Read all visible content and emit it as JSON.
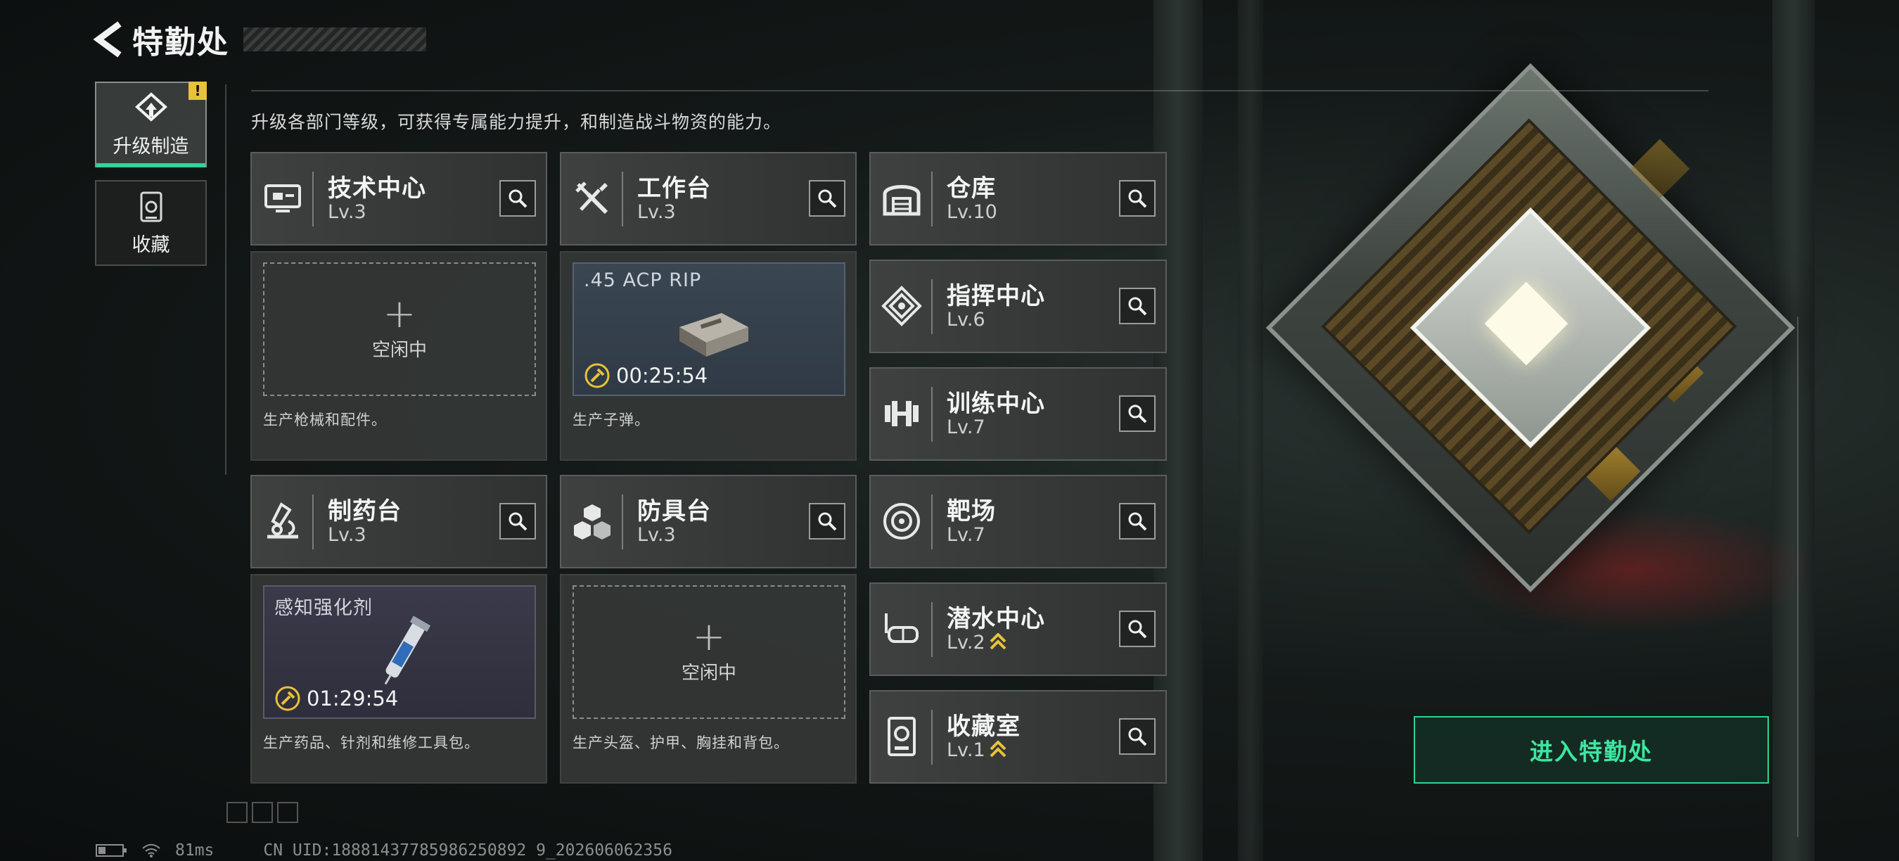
{
  "header": {
    "title": "特勤处"
  },
  "sidenav": [
    {
      "label": "升级制造",
      "icon": "upgrade-icon",
      "active": true,
      "badge": "!"
    },
    {
      "label": "收藏",
      "icon": "collection-icon",
      "active": false
    }
  ],
  "description": "升级各部门等级，可获得专属能力提升，和制造战斗物资的能力。",
  "workshops": [
    {
      "name": "技术中心",
      "level": "Lv.3",
      "icon": "tech-center-icon",
      "slot": {
        "state": "idle",
        "idle_text": "空闲中"
      },
      "desc": "生产枪械和配件。"
    },
    {
      "name": "工作台",
      "level": "Lv.3",
      "icon": "workbench-icon",
      "slot": {
        "state": "busy",
        "item": ".45 ACP RIP",
        "timer": "00:25:54",
        "item_icon": "ammo-box-icon"
      },
      "desc": "生产子弹。"
    },
    {
      "name": "制药台",
      "level": "Lv.3",
      "icon": "pharmacy-icon",
      "slot": {
        "state": "busy",
        "item": "感知强化剂",
        "timer": "01:29:54",
        "item_icon": "syringe-icon"
      },
      "desc": "生产药品、针剂和维修工具包。"
    },
    {
      "name": "防具台",
      "level": "Lv.3",
      "icon": "armor-bench-icon",
      "slot": {
        "state": "idle",
        "idle_text": "空闲中"
      },
      "desc": "生产头盔、护甲、胸挂和背包。"
    }
  ],
  "facilities": [
    {
      "name": "仓库",
      "level": "Lv.10",
      "icon": "warehouse-icon",
      "upgrade": false
    },
    {
      "name": "指挥中心",
      "level": "Lv.6",
      "icon": "command-center-icon",
      "upgrade": false
    },
    {
      "name": "训练中心",
      "level": "Lv.7",
      "icon": "training-center-icon",
      "upgrade": false
    },
    {
      "name": "靶场",
      "level": "Lv.7",
      "icon": "shooting-range-icon",
      "upgrade": false
    },
    {
      "name": "潜水中心",
      "level": "Lv.2",
      "icon": "diving-center-icon",
      "upgrade": true
    },
    {
      "name": "收藏室",
      "level": "Lv.1",
      "icon": "collection-room-icon",
      "upgrade": true
    }
  ],
  "enter_button": "进入特勤处",
  "status": {
    "ping": "81ms",
    "uid": "CN UID:18881437785986250892 9_202606062356"
  },
  "colors": {
    "accent": "#34d399",
    "badge": "#e8c23a",
    "timer_icon": "#e8c23a"
  }
}
